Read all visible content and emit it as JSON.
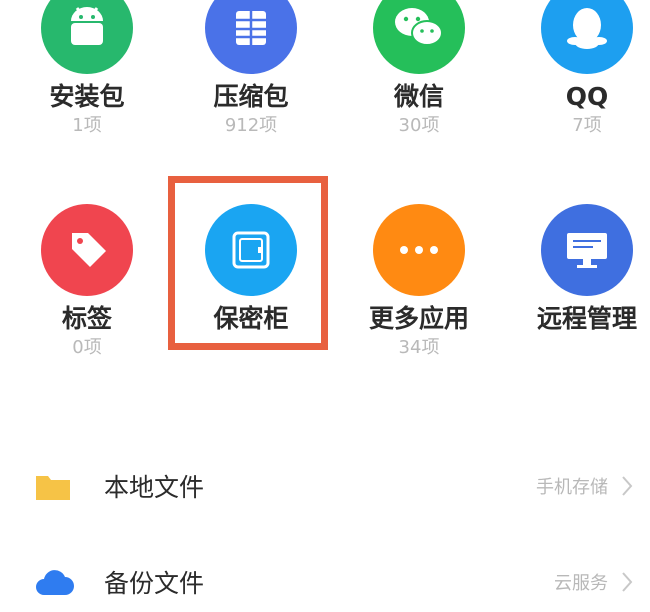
{
  "apps": [
    {
      "label": "安装包",
      "count": "1项",
      "color": "#27b86d",
      "icon": "android-icon"
    },
    {
      "label": "压缩包",
      "count": "912项",
      "color": "#4a72e8",
      "icon": "archive-icon"
    },
    {
      "label": "微信",
      "count": "30项",
      "color": "#25bf5a",
      "icon": "wechat-icon"
    },
    {
      "label": "QQ",
      "count": "7项",
      "color": "#1d9ff0",
      "icon": "qq-penguin-icon"
    },
    {
      "label": "标签",
      "count": "0项",
      "color": "#f0454f",
      "icon": "tag-icon"
    },
    {
      "label": "保密柜",
      "count": "",
      "color": "#1aa5f2",
      "icon": "safe-icon"
    },
    {
      "label": "更多应用",
      "count": "34项",
      "color": "#ff8a12",
      "icon": "more-dots-icon"
    },
    {
      "label": "远程管理",
      "count": "",
      "color": "#3f6fe0",
      "icon": "monitor-icon"
    }
  ],
  "highlight_color": "#e8603f",
  "rows": [
    {
      "label": "本地文件",
      "sub": "手机存储",
      "icon": "folder-icon",
      "color": "#f6c346"
    },
    {
      "label": "备份文件",
      "sub": "云服务",
      "icon": "cloud-icon",
      "color": "#2f7cf0"
    }
  ]
}
